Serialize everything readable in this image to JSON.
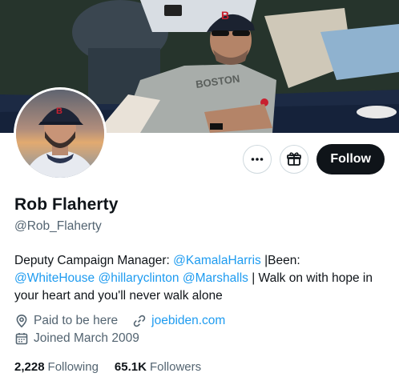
{
  "profile": {
    "name": "Rob Flaherty",
    "handle": "@Rob_Flaherty",
    "banner_cap_text": "BOSTON",
    "avatar_cap_letter": "B"
  },
  "actions": {
    "more_icon": "ellipsis-icon",
    "gift_icon": "gift-icon",
    "follow_label": "Follow"
  },
  "bio": {
    "p1": "Deputy Campaign Manager: ",
    "m1": "@KamalaHarris",
    "p2": " |Been: ",
    "m2": "@WhiteHouse",
    "p3": " ",
    "m3": "@hillaryclinton",
    "p4": " ",
    "m4": "@Marshalls",
    "p5": " | Walk on with hope in your heart and you'll never walk alone"
  },
  "meta": {
    "location": "Paid to be here",
    "website": "joebiden.com",
    "joined": "Joined March 2009"
  },
  "stats": {
    "following_count": "2,228",
    "following_label": "Following",
    "followers_count": "65.1K",
    "followers_label": "Followers"
  },
  "colors": {
    "accent": "#1d9bf0",
    "text": "#0f1419",
    "muted": "#536471",
    "button": "#0f1419"
  }
}
